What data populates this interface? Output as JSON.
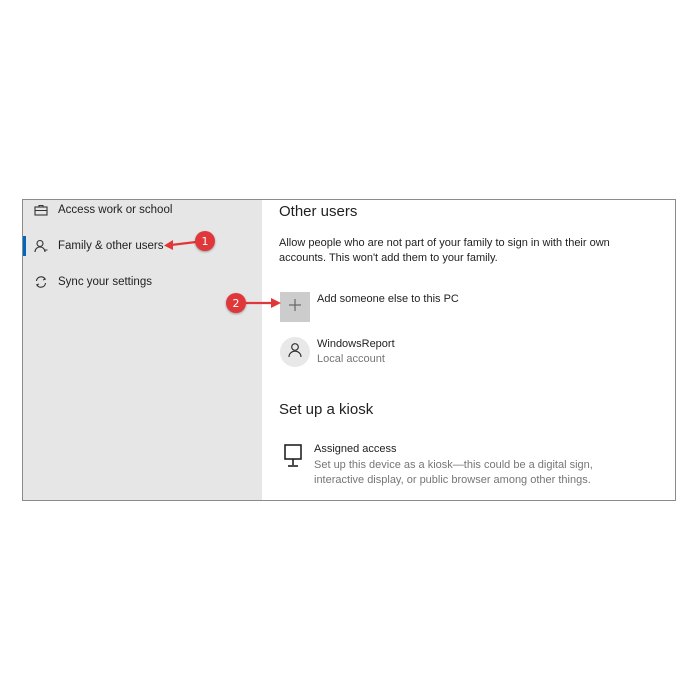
{
  "sidebar": {
    "items": [
      {
        "label": "Access work or school",
        "icon": "briefcase-icon"
      },
      {
        "label": "Family & other users",
        "icon": "person-icon",
        "active": true
      },
      {
        "label": "Sync your settings",
        "icon": "sync-icon"
      }
    ]
  },
  "main": {
    "other_users": {
      "title": "Other users",
      "description": "Allow people who are not part of your family to sign in with their own accounts. This won't add them to your family.",
      "add_label": "Add someone else to this PC",
      "user": {
        "name": "WindowsReport",
        "type": "Local account"
      }
    },
    "kiosk": {
      "title": "Set up a kiosk",
      "item_name": "Assigned access",
      "item_description": "Set up this device as a kiosk—this could be a digital sign, interactive display, or public browser among other things."
    }
  },
  "annotations": {
    "badge1": "1",
    "badge2": "2",
    "color": "#e0383a"
  },
  "colors": {
    "sidebar_bg": "#e6e6e6",
    "accent": "#0067c0",
    "add_button_bg": "#cccccc"
  }
}
